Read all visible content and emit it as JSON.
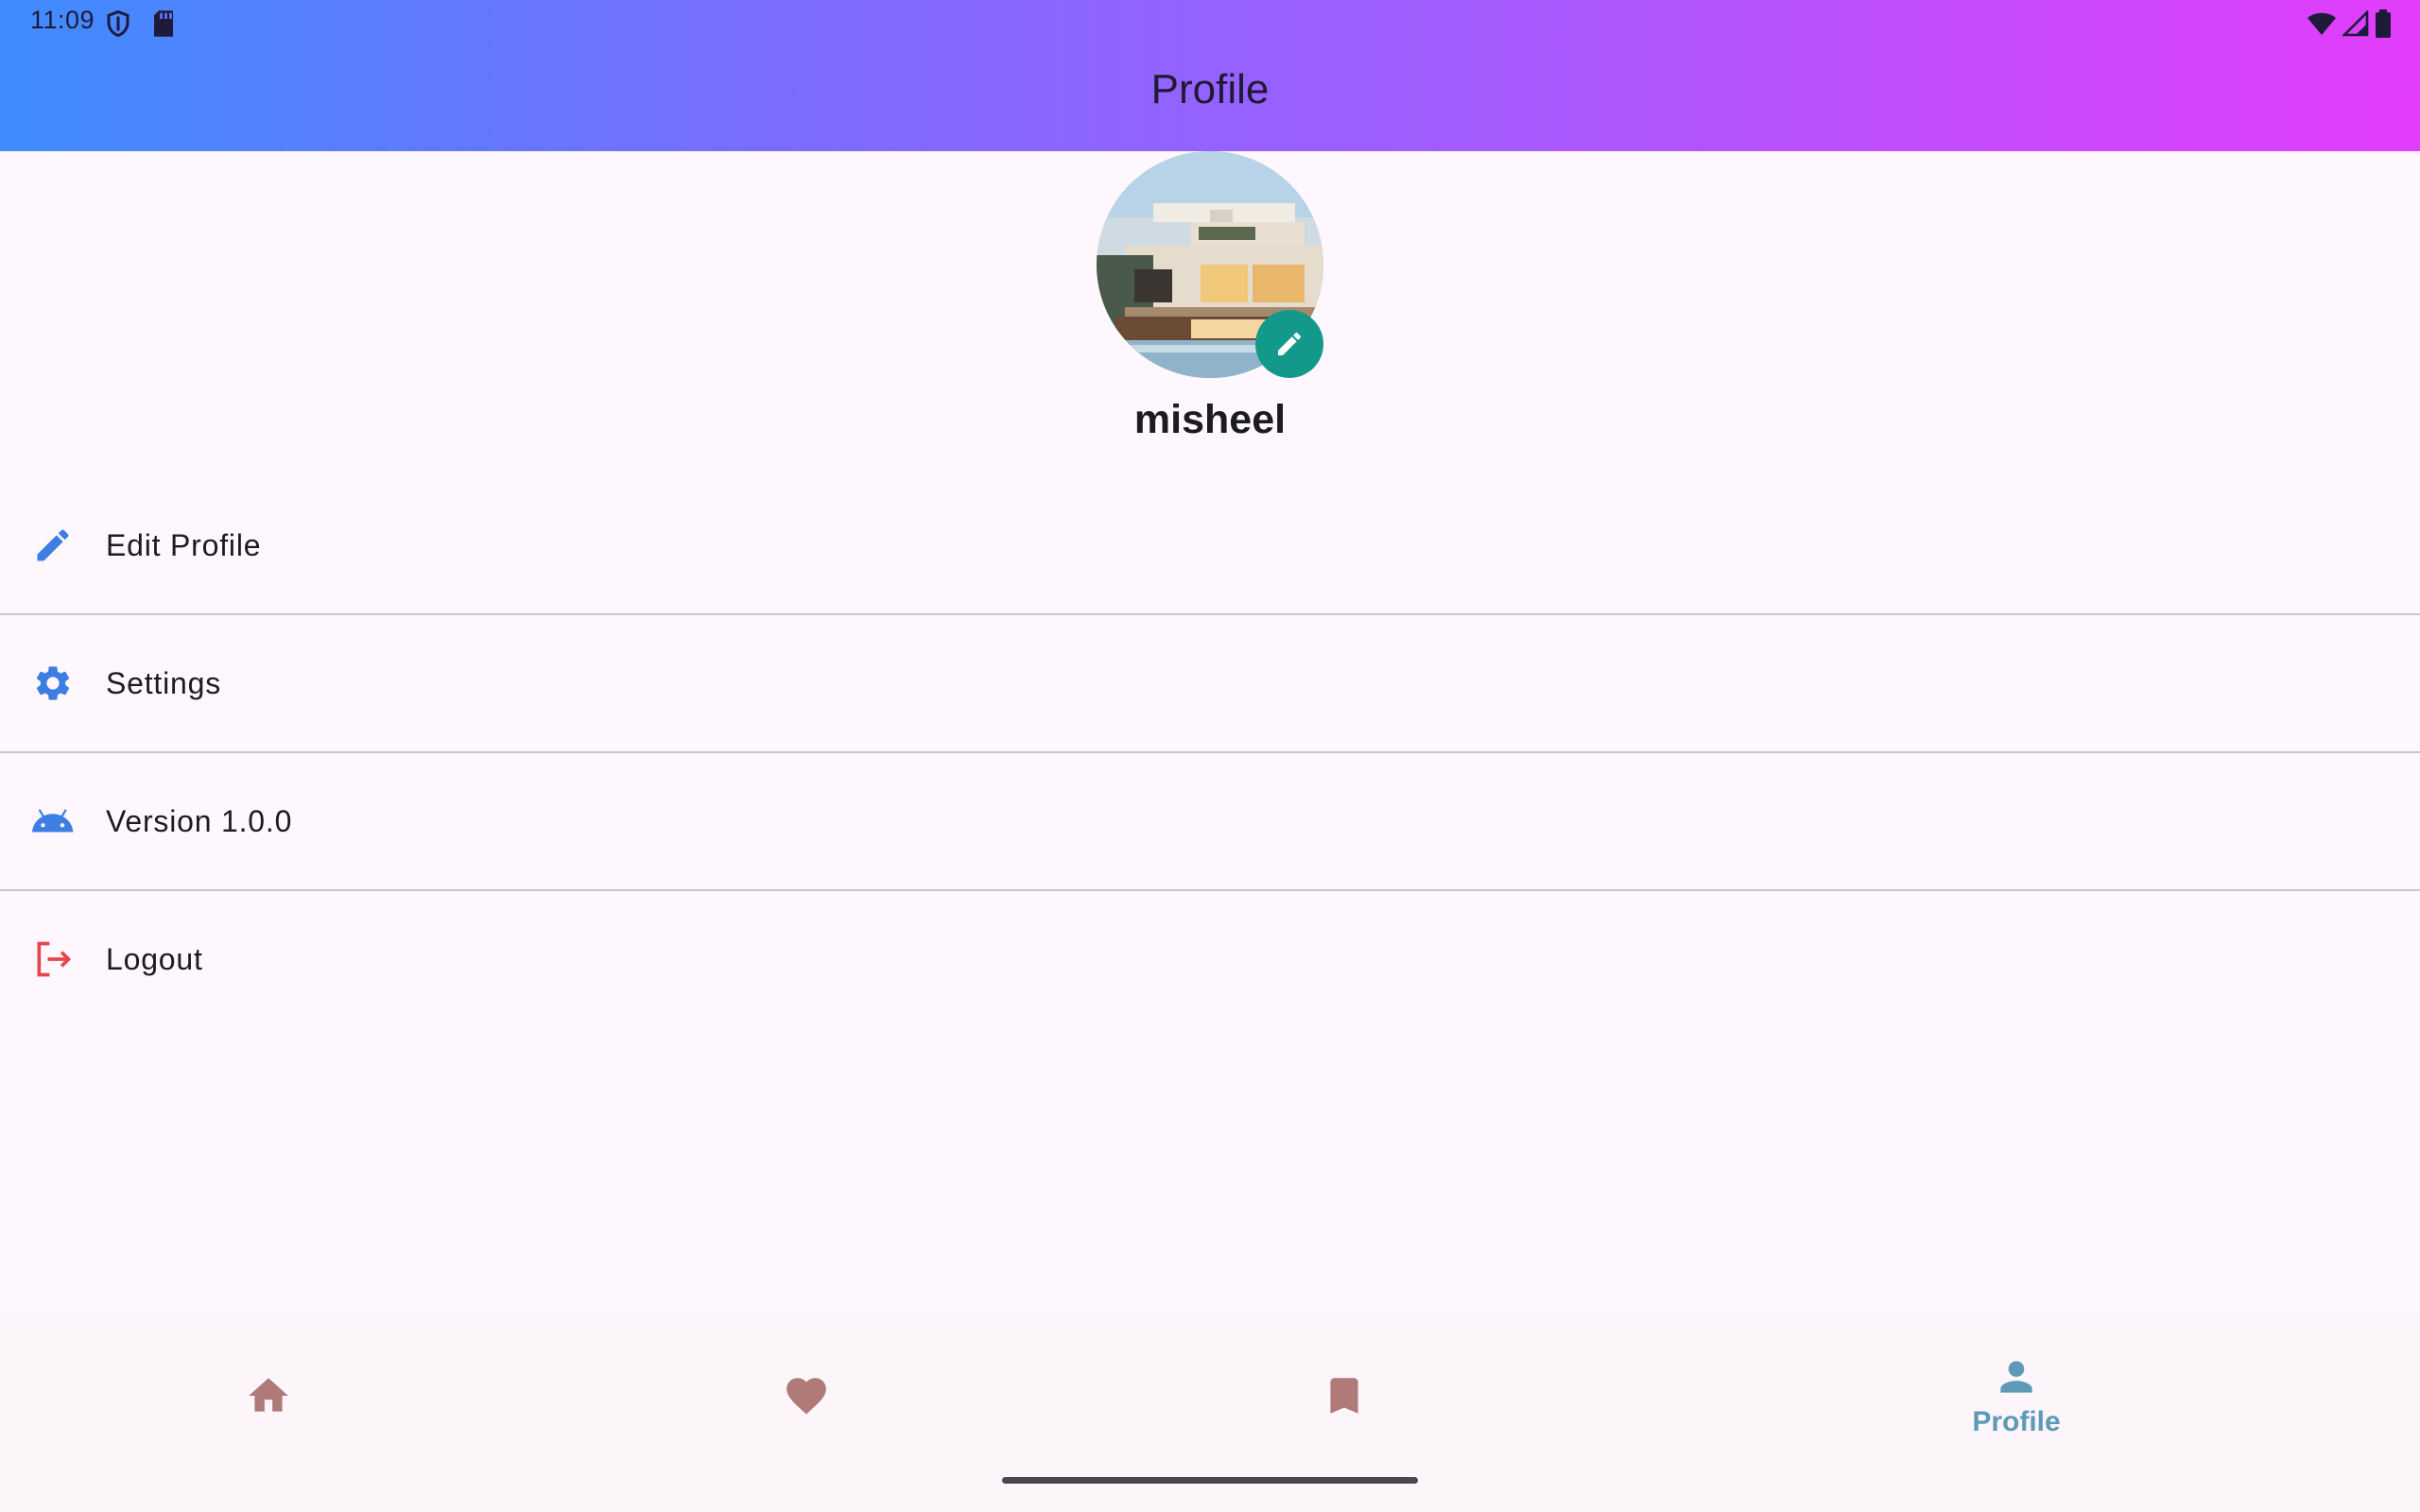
{
  "status_bar": {
    "time": "11:09",
    "icons": [
      "shield-icon",
      "sd-card-icon",
      "wifi-icon",
      "cell-signal-icon",
      "battery-icon"
    ]
  },
  "app_bar": {
    "title": "Profile",
    "gradient": [
      "#3f8cff",
      "#7a6cff",
      "#a55bff",
      "#e23dfb"
    ]
  },
  "profile": {
    "username": "misheel",
    "avatar": "house-photo",
    "edit_icon": "pencil-icon",
    "edit_badge_color": "#13998a"
  },
  "menu": {
    "items": [
      {
        "label": "Edit Profile",
        "icon": "pencil-icon",
        "color": "#3d7ee3"
      },
      {
        "label": "Settings",
        "icon": "gear-icon",
        "color": "#3d7ee3"
      },
      {
        "label": "Version 1.0.0",
        "icon": "android-icon",
        "color": "#3d7ee3"
      },
      {
        "label": "Logout",
        "icon": "logout-icon",
        "color": "#e5454b"
      }
    ]
  },
  "bottom_nav": {
    "items": [
      {
        "name": "home",
        "icon": "home-icon",
        "label": ""
      },
      {
        "name": "favorites",
        "icon": "heart-icon",
        "label": ""
      },
      {
        "name": "saved",
        "icon": "bookmark-icon",
        "label": ""
      },
      {
        "name": "profile",
        "icon": "person-icon",
        "label": "Profile",
        "active": true
      }
    ],
    "inactive_color": "#b07a78",
    "active_color": "#5c9ab8"
  }
}
